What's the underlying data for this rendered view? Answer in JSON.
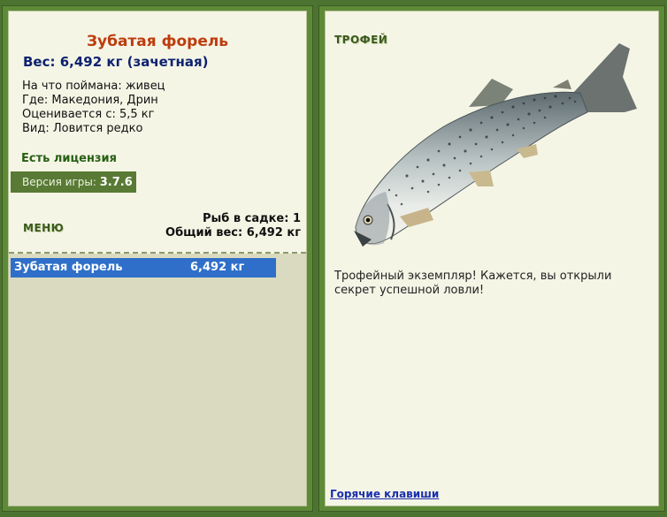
{
  "fish": {
    "name": "Зубатая форель",
    "weight_line": "Вес: 6,492 кг (зачетная)",
    "bait": "На что поймана: живец",
    "location": "Где: Македония, Дрин",
    "valued_from": "Оценивается с: 5,5 кг",
    "rarity": "Вид: Ловится редко"
  },
  "license": "Есть лицензия",
  "version": {
    "label": "Версия игры:",
    "value": "3.7.6"
  },
  "menu_label": "МЕНЮ",
  "cage": {
    "count_line": "Рыб в садке: 1",
    "total_line": "Общий вес: 6,492 кг",
    "items": [
      {
        "name": "Зубатая форель",
        "weight": "6,492 кг"
      }
    ]
  },
  "trophy": {
    "label": "ТРОФЕЙ",
    "description": "Трофейный экземпляр! Кажется, вы открыли секрет успешной ловли!"
  },
  "hotkeys_link": "Горячие клавиши",
  "colors": {
    "background": "#4d7330",
    "panel": "#f5f5e6",
    "title": "#bd3c0d",
    "weight": "#0d2270",
    "selected_row": "#2f6fc9"
  }
}
